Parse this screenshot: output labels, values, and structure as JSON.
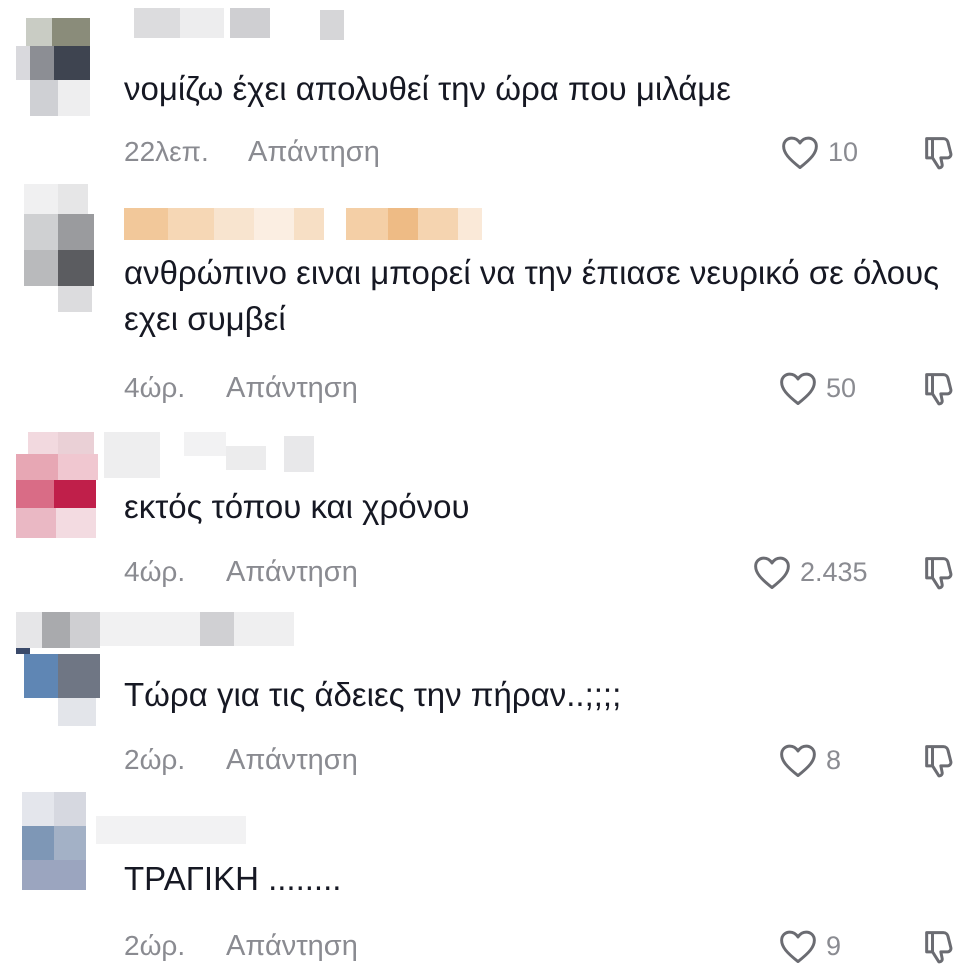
{
  "comments": [
    {
      "text": "νομίζω έχει απολυθεί την ώρα που μιλάμε",
      "time": "22λεπ.",
      "reply_label": "Απάντηση",
      "likes": "10"
    },
    {
      "text": "ανθρώπινο ειναι μπορεί να την έπιασε νευρικό σε όλους εχει συμβεί",
      "time": "4ώρ.",
      "reply_label": "Απάντηση",
      "likes": "50"
    },
    {
      "text": "εκτός τόπου και χρόνου",
      "time": "4ώρ.",
      "reply_label": "Απάντηση",
      "likes": "2.435"
    },
    {
      "text": "Τώρα για τις άδειες την πήραν..;;;;",
      "time": "2ώρ.",
      "reply_label": "Απάντηση",
      "likes": "8"
    },
    {
      "text": "ΤΡΑΓΙΚΗ ........",
      "time": "2ώρ.",
      "reply_label": "Απάντηση",
      "likes": "9"
    }
  ],
  "colors": {
    "text": "#161823",
    "muted": "#8a8b91",
    "icon": "#6b6c72"
  },
  "icons": {
    "like": "heart-outline-icon",
    "dislike": "thumbs-down-icon"
  }
}
